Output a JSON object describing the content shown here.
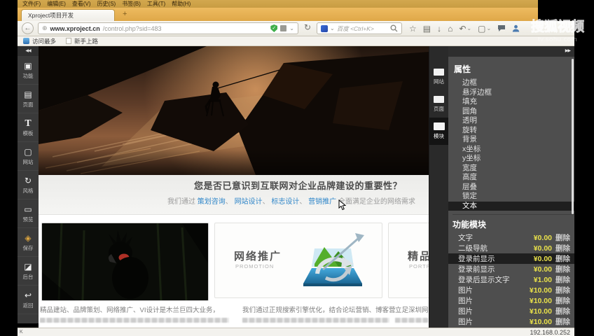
{
  "window": {
    "menu": [
      "文件(F)",
      "编辑(E)",
      "查看(V)",
      "历史(S)",
      "书签(B)",
      "工具(T)",
      "帮助(H)"
    ],
    "tab_title": "Xproject项目开发",
    "url_host": "www.xproject.cn",
    "url_path": "/control.php?sid=483",
    "search_text": "百度 <Ctrl+K>",
    "bookmarks": [
      "访问最多",
      "新手上路"
    ],
    "status_ip": "192.168.0.252",
    "status_left": "K"
  },
  "icons": {
    "back": "←",
    "globe": "⊕",
    "caret": "⌄",
    "reload": "↻",
    "star": "☆",
    "clipboard": "▤",
    "download": "↓",
    "home": "⌂",
    "undo": "↶",
    "crop": "▢",
    "plus": "+",
    "collapse_left": "◀◀",
    "expand_right": "▶▶",
    "shield_check": "✓"
  },
  "left_toolbar": {
    "tools": [
      {
        "icon": "▣",
        "label": "功能"
      },
      {
        "icon": "▤",
        "label": "页面"
      },
      {
        "icon": "T",
        "label": "模板"
      },
      {
        "icon": "▢",
        "label": "网站"
      },
      {
        "icon": "↻",
        "label": "风格"
      },
      {
        "icon": "▭",
        "label": "预览"
      },
      {
        "icon": "◈",
        "label": "保存"
      },
      {
        "icon": "◪",
        "label": "后台"
      },
      {
        "icon": "↩",
        "label": "返回"
      }
    ]
  },
  "side_tabs": [
    {
      "label": "网站"
    },
    {
      "label": "页面"
    },
    {
      "label": "模块"
    }
  ],
  "page": {
    "headline": "您是否已意识到互联网对企业品牌建设的重要性？",
    "sub_prefix": "我们通过 ",
    "links": [
      "策划咨询",
      "网站设计",
      "标志设计",
      "营销推广"
    ],
    "link_sep": "、 ",
    "sub_suffix": " 全面满足企业的网络需求",
    "cards": [
      {
        "title": "网络推广",
        "subtitle": "PROMOTION"
      },
      {
        "title": "精品案例",
        "subtitle": "PORTFOLIO"
      }
    ],
    "footer_cols": [
      "精品建站、品牌策划、网络推广、VI设计是木兰巨四大业务，",
      "我们通过正规搜索引擎优化，结合论坛营销、博客营销、邮",
      "立足深圳网站建"
    ]
  },
  "properties_panel": {
    "title": "属性",
    "items": [
      "边框",
      "悬浮边框",
      "填充",
      "圆角",
      "透明",
      "旋转",
      "背景",
      "x坐标",
      "y坐标",
      "宽度",
      "高度",
      "层叠",
      "锁定",
      "文本"
    ],
    "modules_title": "功能模块",
    "modules": [
      {
        "name": "文字",
        "price": "¥0.00",
        "action": "删除"
      },
      {
        "name": "二级导航",
        "price": "¥0.00",
        "action": "删除"
      },
      {
        "name": "登录前显示",
        "price": "¥0.00",
        "action": "删除"
      },
      {
        "name": "登录前显示",
        "price": "¥0.00",
        "action": "删除"
      },
      {
        "name": "登录后显示文字",
        "price": "¥1.00",
        "action": "删除"
      },
      {
        "name": "图片",
        "price": "¥10.00",
        "action": "删除"
      },
      {
        "name": "图片",
        "price": "¥10.00",
        "action": "删除"
      },
      {
        "name": "图片",
        "price": "¥10.00",
        "action": "删除"
      },
      {
        "name": "图片",
        "price": "¥10.00",
        "action": "删除"
      }
    ]
  },
  "watermark": {
    "logo": "搜狐视频",
    "url": "tv.sohu.com"
  },
  "colors": {
    "firefox_orange": "#e0a94a",
    "panel_gray": "#4e4e4e",
    "price_yellow": "#e8e04a",
    "link_blue": "#2f86c9",
    "shield_green": "#3fae49"
  }
}
